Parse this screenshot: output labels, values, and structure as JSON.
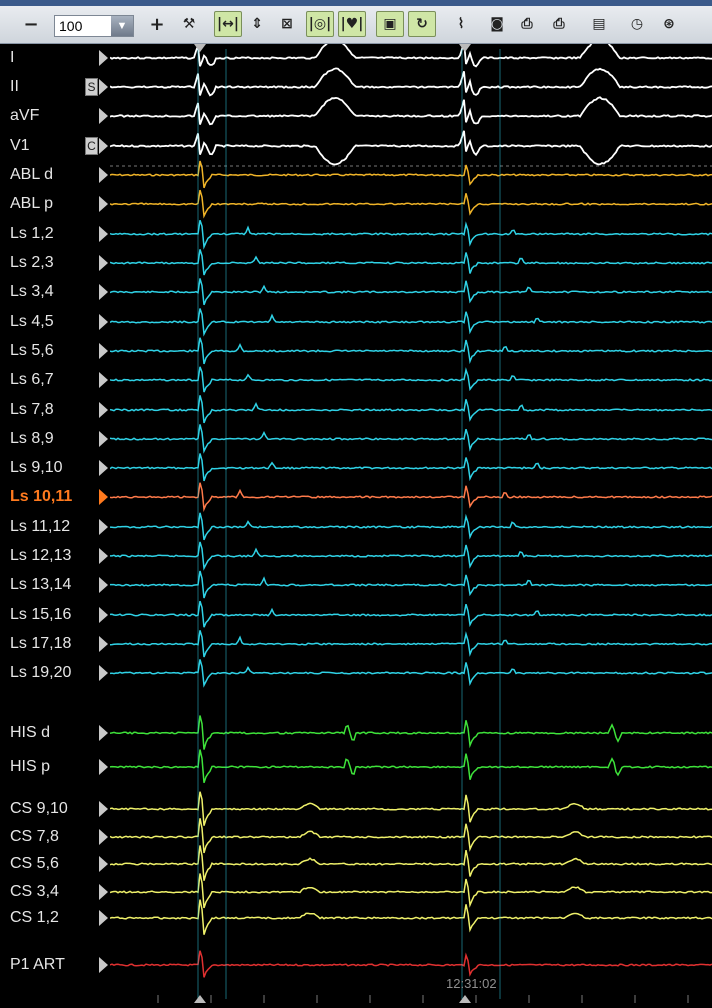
{
  "toolbar": {
    "zoom_out_symbol": "−",
    "zoom_value": "100",
    "zoom_in_symbol": "+",
    "buttons": [
      {
        "name": "tools-icon",
        "glyph": "⚒"
      },
      {
        "name": "horizontal-expand-icon",
        "glyph": "|↔|"
      },
      {
        "name": "vertical-scale-icon",
        "glyph": "⇕"
      },
      {
        "name": "fit-icon",
        "glyph": "⊠"
      },
      {
        "name": "caliper-icon",
        "glyph": "|◎|"
      },
      {
        "name": "heart-caliper-icon",
        "glyph": "|♥|"
      },
      {
        "name": "monitor-icon",
        "glyph": "▣"
      },
      {
        "name": "sync-icon",
        "glyph": "↻"
      },
      {
        "name": "trigger-icon",
        "glyph": "⌇"
      },
      {
        "name": "camera-icon",
        "glyph": "◙"
      },
      {
        "name": "print-icon",
        "glyph": "⎙"
      },
      {
        "name": "printer-icon",
        "glyph": "⎙"
      },
      {
        "name": "table-icon",
        "glyph": "▤"
      },
      {
        "name": "clock-icon",
        "glyph": "◷"
      },
      {
        "name": "settings-wheel-icon",
        "glyph": "⊛"
      }
    ]
  },
  "channels": [
    {
      "label": "I",
      "color": "#ffffff"
    },
    {
      "label": "II",
      "color": "#ffffff",
      "badge": "S"
    },
    {
      "label": "aVF",
      "color": "#ffffff"
    },
    {
      "label": "V1",
      "color": "#ffffff",
      "badge": "C"
    },
    {
      "label": "ABL d",
      "color": "#f0b428"
    },
    {
      "label": "ABL p",
      "color": "#f0b428"
    },
    {
      "label": "Ls 1,2",
      "color": "#2fd2e6"
    },
    {
      "label": "Ls 2,3",
      "color": "#2fd2e6"
    },
    {
      "label": "Ls 3,4",
      "color": "#2fd2e6"
    },
    {
      "label": "Ls 4,5",
      "color": "#2fd2e6"
    },
    {
      "label": "Ls 5,6",
      "color": "#2fd2e6"
    },
    {
      "label": "Ls 6,7",
      "color": "#2fd2e6"
    },
    {
      "label": "Ls 7,8",
      "color": "#2fd2e6"
    },
    {
      "label": "Ls 8,9",
      "color": "#2fd2e6"
    },
    {
      "label": "Ls 9,10",
      "color": "#2fd2e6"
    },
    {
      "label": "Ls 10,11",
      "color": "#ff7a4a",
      "selected": true
    },
    {
      "label": "Ls 11,12",
      "color": "#2fd2e6"
    },
    {
      "label": "Ls 12,13",
      "color": "#2fd2e6"
    },
    {
      "label": "Ls 13,14",
      "color": "#2fd2e6"
    },
    {
      "label": "Ls 15,16",
      "color": "#2fd2e6"
    },
    {
      "label": "Ls 17,18",
      "color": "#2fd2e6"
    },
    {
      "label": "Ls 19,20",
      "color": "#2fd2e6"
    },
    {
      "label": "HIS d",
      "color": "#3ee23a"
    },
    {
      "label": "HIS p",
      "color": "#3ee23a"
    },
    {
      "label": "CS 9,10",
      "color": "#eef06a"
    },
    {
      "label": "CS 7,8",
      "color": "#eef06a"
    },
    {
      "label": "CS 5,6",
      "color": "#eef06a"
    },
    {
      "label": "CS 3,4",
      "color": "#eef06a"
    },
    {
      "label": "CS 1,2",
      "color": "#eef06a"
    },
    {
      "label": "P1 ART",
      "color": "#e03030"
    }
  ],
  "timestamp": "12:31:02",
  "colors": {
    "ecg": "#ffffff",
    "ablation": "#f0b428",
    "lasso": "#2fd2e6",
    "selected": "#ff7a4a",
    "his": "#3ee23a",
    "cs": "#eef06a",
    "art": "#e03030"
  }
}
